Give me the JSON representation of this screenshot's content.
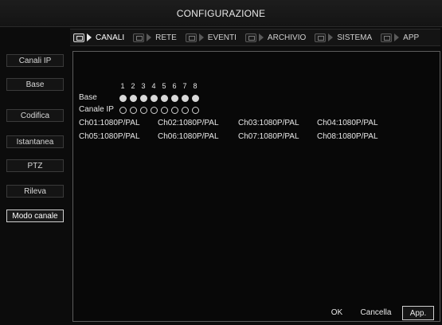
{
  "window": {
    "title": "CONFIGURAZIONE"
  },
  "tabs": [
    {
      "label": "CANALI",
      "icon": "channels-icon",
      "active": true
    },
    {
      "label": "RETE",
      "icon": "network-icon",
      "active": false
    },
    {
      "label": "EVENTI",
      "icon": "events-icon",
      "active": false
    },
    {
      "label": "ARCHIVIO",
      "icon": "storage-icon",
      "active": false
    },
    {
      "label": "SISTEMA",
      "icon": "system-icon",
      "active": false
    },
    {
      "label": "APP",
      "icon": "app-icon",
      "active": false
    }
  ],
  "sidebar": {
    "items": [
      {
        "label": "Canali IP",
        "active": false
      },
      {
        "label": "Base",
        "active": false
      },
      {
        "label": "Codifica",
        "active": false
      },
      {
        "label": "Istantanea",
        "active": false
      },
      {
        "label": "PTZ",
        "active": false
      },
      {
        "label": "Rileva",
        "active": false
      },
      {
        "label": "Modo canale",
        "active": true
      }
    ]
  },
  "mode_grid": {
    "columns": [
      "1",
      "2",
      "3",
      "4",
      "5",
      "6",
      "7",
      "8"
    ],
    "rows": [
      {
        "label": "Base",
        "selected": [
          true,
          true,
          true,
          true,
          true,
          true,
          true,
          true
        ]
      },
      {
        "label": "Canale IP",
        "selected": [
          false,
          false,
          false,
          false,
          false,
          false,
          false,
          false
        ]
      }
    ]
  },
  "channels": [
    "Ch01:1080P/PAL",
    "Ch02:1080P/PAL",
    "Ch03:1080P/PAL",
    "Ch04:1080P/PAL",
    "Ch05:1080P/PAL",
    "Ch06:1080P/PAL",
    "Ch07:1080P/PAL",
    "Ch08:1080P/PAL"
  ],
  "footer": {
    "ok_label": "OK",
    "cancel_label": "Cancella",
    "apply_label": "App."
  },
  "colors": {
    "background": "#0c0c0c",
    "text": "#e8e8e8",
    "border": "#5c5c5c",
    "active_border": "#cfcfcf"
  }
}
